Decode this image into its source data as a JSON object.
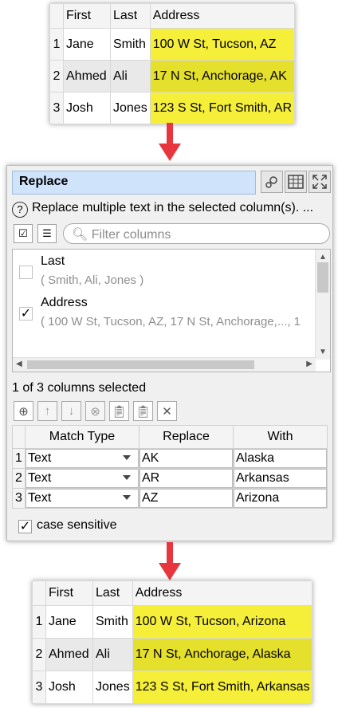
{
  "input_table": {
    "headers": [
      "First",
      "Last",
      "Address"
    ],
    "rows": [
      {
        "n": "1",
        "first": "Jane",
        "last": "Smith",
        "address": "100 W St, Tucson, AZ"
      },
      {
        "n": "2",
        "first": "Ahmed",
        "last": "Ali",
        "address": "17 N St, Anchorage, AK"
      },
      {
        "n": "3",
        "first": "Josh",
        "last": "Jones",
        "address": "123 S St, Fort Smith, AR"
      }
    ]
  },
  "panel": {
    "title": "Replace",
    "description": "Replace multiple text in the selected column(s). ...",
    "filter_placeholder": "Filter columns",
    "columns": [
      {
        "name": "Last",
        "values": "( Smith, Ali, Jones )",
        "checked": false
      },
      {
        "name": "Address",
        "values": "( 100 W St, Tucson, AZ, 17 N St, Anchorage,..., 1",
        "checked": true
      }
    ],
    "selection_count": "1 of 3 columns selected",
    "match_table": {
      "headers": [
        "Match Type",
        "Replace",
        "With"
      ],
      "rows": [
        {
          "n": "1",
          "type": "Text",
          "replace": "AK",
          "with": "Alaska"
        },
        {
          "n": "2",
          "type": "Text",
          "replace": "AR",
          "with": "Arkansas"
        },
        {
          "n": "3",
          "type": "Text",
          "replace": "AZ",
          "with": "Arizona"
        }
      ]
    },
    "case_sensitive_label": "case sensitive",
    "case_sensitive_checked": true
  },
  "output_table": {
    "headers": [
      "First",
      "Last",
      "Address"
    ],
    "rows": [
      {
        "n": "1",
        "first": "Jane",
        "last": "Smith",
        "address": "100 W St, Tucson, Arizona"
      },
      {
        "n": "2",
        "first": "Ahmed",
        "last": "Ali",
        "address": "17 N St, Anchorage, Alaska"
      },
      {
        "n": "3",
        "first": "Josh",
        "last": "Jones",
        "address": "123 S St, Fort Smith, Arkansas"
      }
    ]
  },
  "colors": {
    "arrow": "#e8363f",
    "highlight": "#f5ef3a",
    "title_bg": "#cfe3fb"
  }
}
